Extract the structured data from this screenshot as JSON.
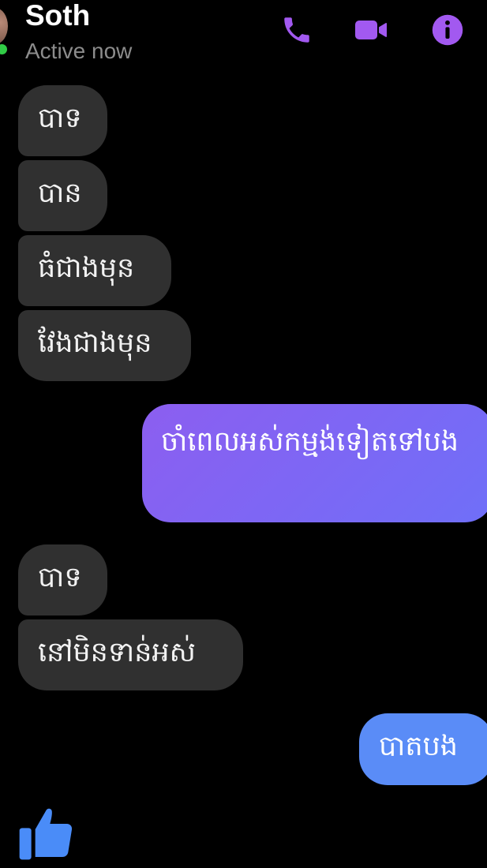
{
  "header": {
    "contact_name": "Soth",
    "status": "Active now",
    "icons": [
      "phone-icon",
      "video-camera-icon",
      "info-icon"
    ],
    "accent_color": "#a259f0"
  },
  "messages": [
    {
      "direction": "incoming",
      "text": "បាទ"
    },
    {
      "direction": "incoming",
      "text": "បាន"
    },
    {
      "direction": "incoming",
      "text": "ធំជាងមុន"
    },
    {
      "direction": "incoming",
      "text": "វែងជាងមុន"
    },
    {
      "direction": "outgoing",
      "text": "ចាំពេលអស់កម្មង់ទៀតទៅបង"
    },
    {
      "direction": "incoming",
      "text": "បាទ"
    },
    {
      "direction": "incoming",
      "text": "នៅមិនទាន់អស់"
    },
    {
      "direction": "outgoing",
      "text": "បាតបង"
    }
  ],
  "colors": {
    "incoming_bubble": "#303030",
    "outgoing_bubble_gradient": [
      "#8c5ef0",
      "#6f6ff8"
    ],
    "outgoing_bubble_last": "#5a8cf7",
    "online_dot": "#31cc46",
    "like_icon": "#4a8cf8"
  },
  "footer": {
    "icon": "thumbs-up-icon"
  }
}
